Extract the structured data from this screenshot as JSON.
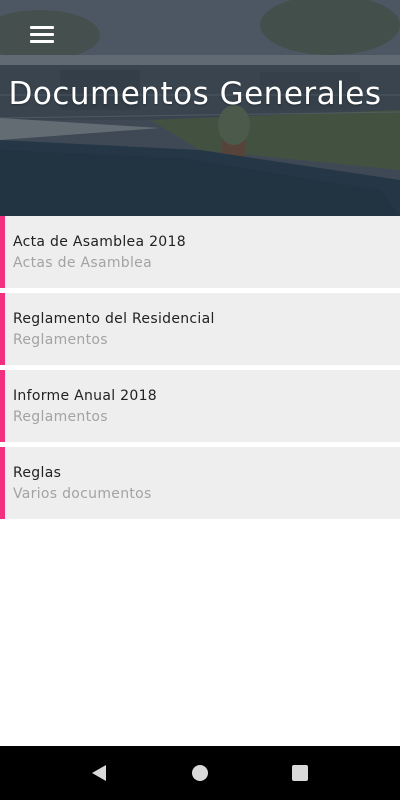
{
  "header": {
    "title": "Documentos Generales",
    "menu_icon": "menu-icon"
  },
  "documents": [
    {
      "title": "Acta de Asamblea 2018",
      "category": "Actas de Asamblea"
    },
    {
      "title": "Reglamento del Residencial",
      "category": "Reglamentos"
    },
    {
      "title": "Informe Anual 2018",
      "category": "Reglamentos"
    },
    {
      "title": "Reglas",
      "category": "Varios documentos"
    }
  ],
  "nav_bar": {
    "back_icon": "back-icon",
    "home_icon": "home-icon",
    "recent_icon": "recent-apps-icon"
  },
  "colors": {
    "accent": "#f2307f",
    "item_background": "#eeeeee",
    "subtitle": "#a3a3a3"
  }
}
